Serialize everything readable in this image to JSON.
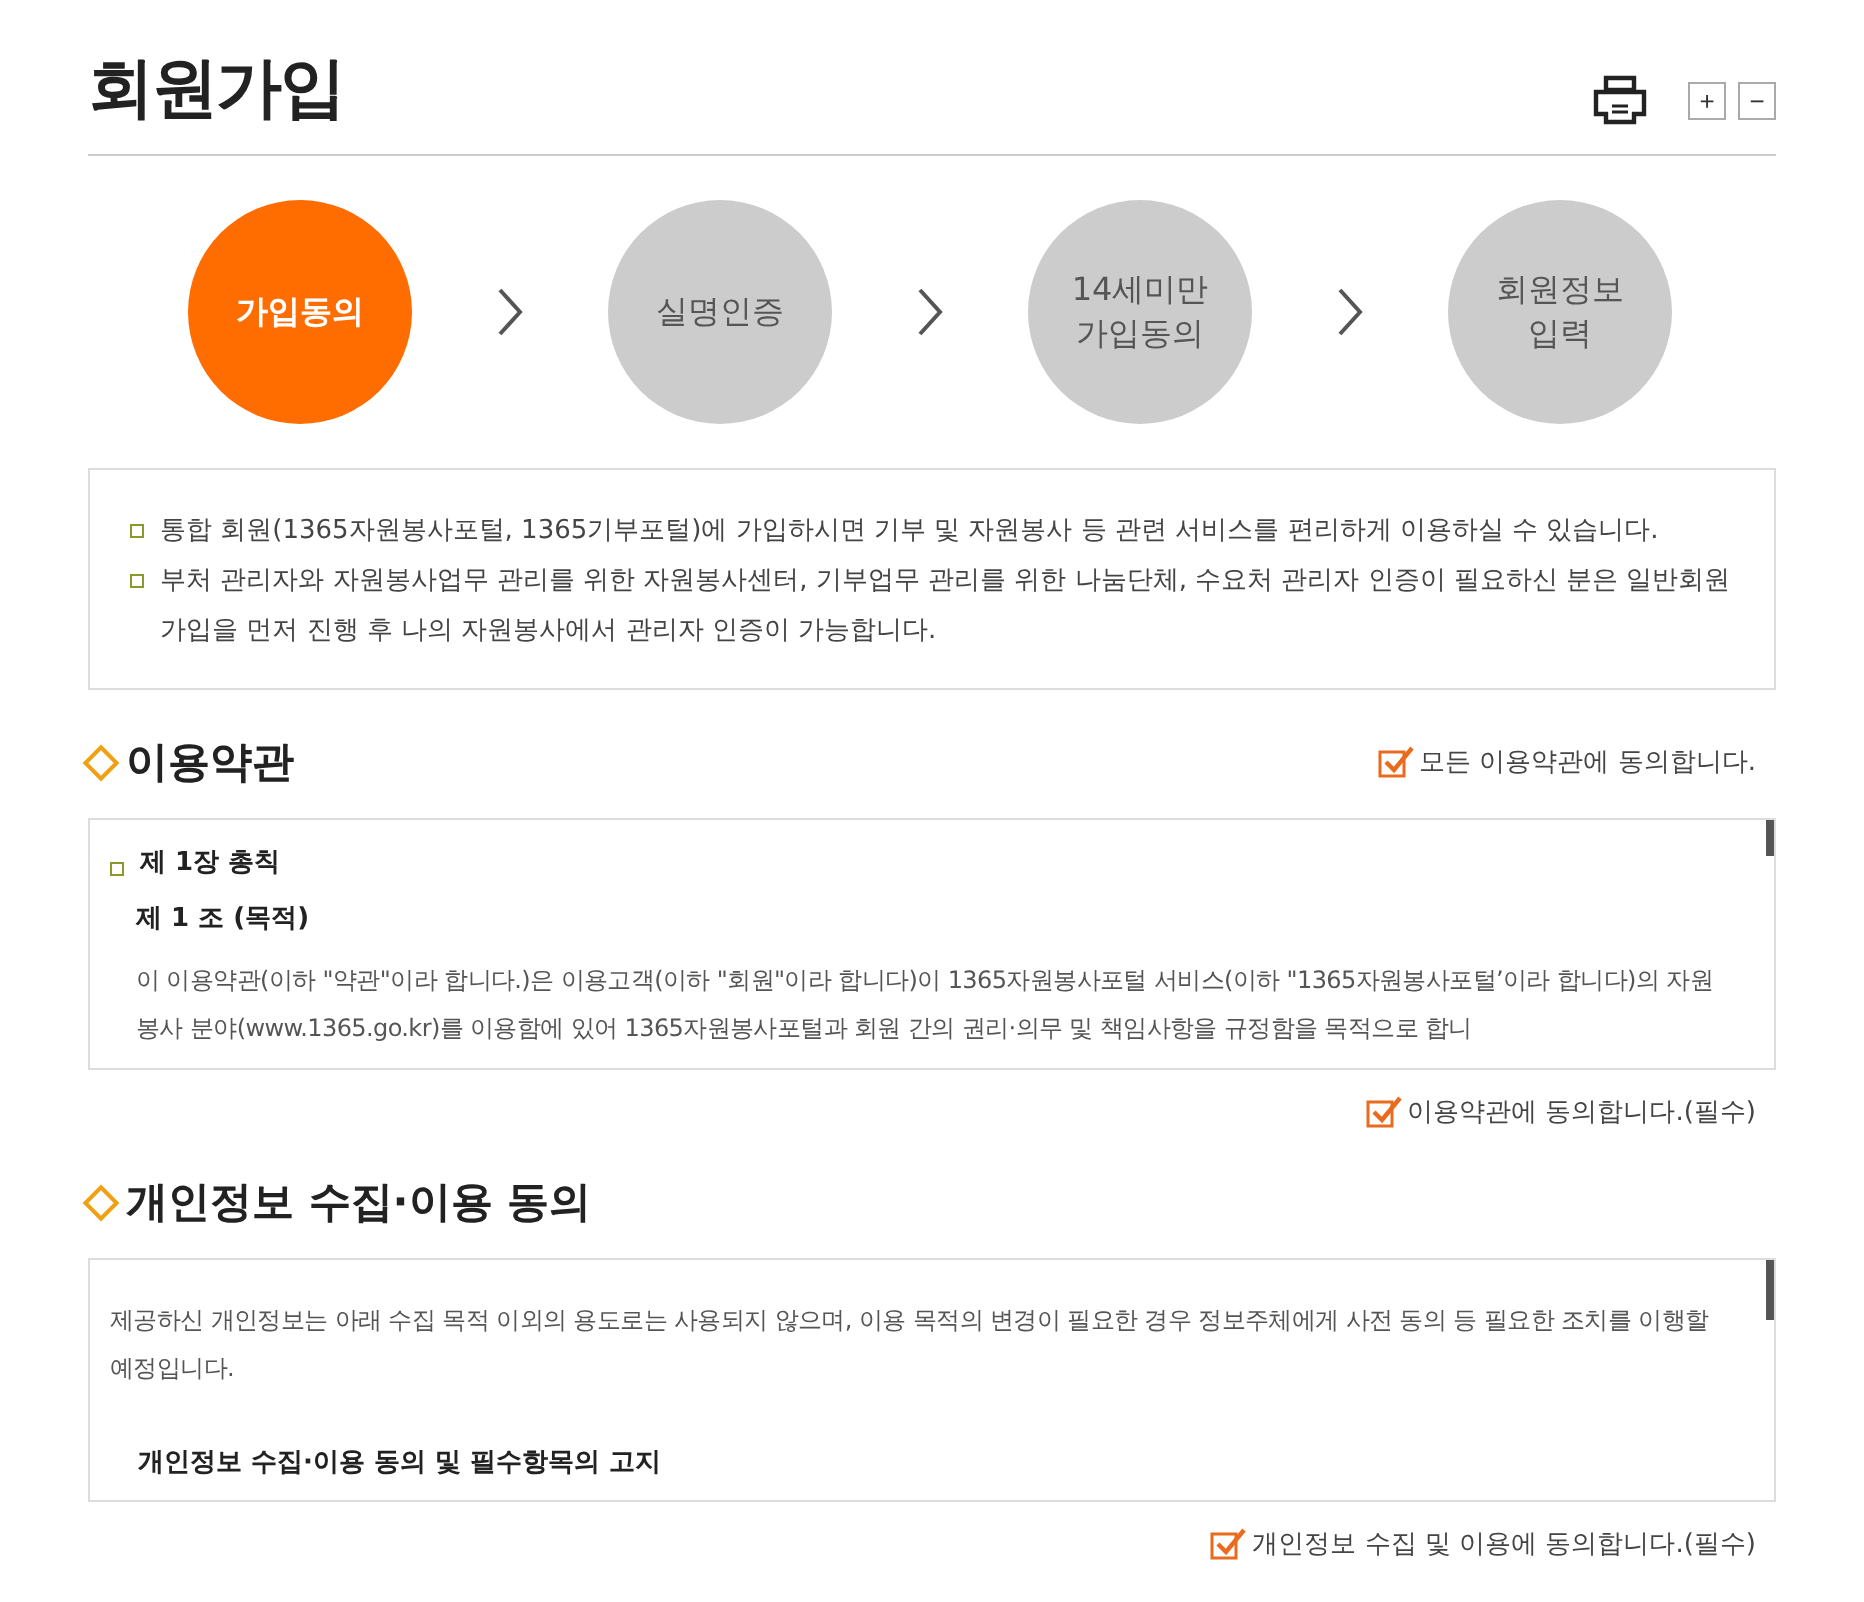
{
  "page_title": "회원가입",
  "tools": {
    "zoom_in": "+",
    "zoom_out": "−"
  },
  "steps": [
    {
      "label": "가입동의",
      "selected": true
    },
    {
      "label": "실명인증",
      "selected": false
    },
    {
      "label": "14세미만\n가입동의",
      "selected": false
    },
    {
      "label": "회원정보\n입력",
      "selected": false
    }
  ],
  "notices": [
    "통합 회원(1365자원봉사포털, 1365기부포털)에 가입하시면 기부 및 자원봉사 등 관련 서비스를 편리하게 이용하실 수 있습니다.",
    "부처 관리자와 자원봉사업무 관리를 위한 자원봉사센터, 기부업무 관리를 위한 나눔단체, 수요처 관리자 인증이 필요하신 분은 일반회원 가입을 먼저 진행 후 나의 자원봉사에서 관리자 인증이 가능합니다."
  ],
  "terms": {
    "title": "이용약관",
    "agree_all": {
      "label": "모든 이용약관에 동의합니다.",
      "checked": true
    },
    "chapter": "제 1장 총칙",
    "article": "제 1 조 (목적)",
    "body": "이 이용약관(이하 \"약관\"이라 합니다.)은 이용고객(이하 \"회원\"이라 합니다)이 1365자원봉사포털 서비스(이하 \"1365자원봉사포털’이라 합니다)의 자원봉사 분야(www.1365.go.kr)를 이용함에 있어 1365자원봉사포털과 회원 간의 권리·의무 및 책임사항을 규정함을 목적으로 합니",
    "agree": {
      "label": "이용약관에 동의합니다.(필수)",
      "checked": true
    }
  },
  "privacy": {
    "title": "개인정보 수집·이용 동의",
    "intro": "제공하신 개인정보는 아래 수집 목적 이외의 용도로는 사용되지 않으며, 이용 목적의 변경이 필요한 경우 정보주체에게 사전 동의 등 필요한 조치를 이행할 예정입니다.",
    "heading": "개인정보 수집·이용 동의 및 필수항목의 고지",
    "agree": {
      "label": "개인정보 수집 및 이용에 동의합니다.(필수)",
      "checked": true
    }
  }
}
